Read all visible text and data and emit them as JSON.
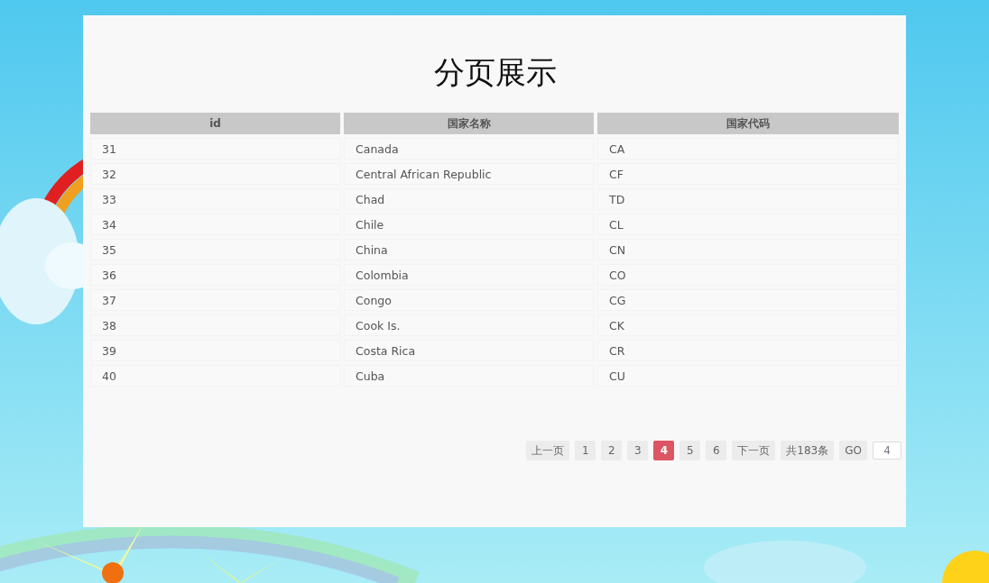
{
  "title": "分页展示",
  "table": {
    "columns": [
      "id",
      "国家名称",
      "国家代码"
    ],
    "rows": [
      [
        "31",
        "Canada",
        "CA"
      ],
      [
        "32",
        "Central African Republic",
        "CF"
      ],
      [
        "33",
        "Chad",
        "TD"
      ],
      [
        "34",
        "Chile",
        "CL"
      ],
      [
        "35",
        "China",
        "CN"
      ],
      [
        "36",
        "Colombia",
        "CO"
      ],
      [
        "37",
        "Congo",
        "CG"
      ],
      [
        "38",
        "Cook Is.",
        "CK"
      ],
      [
        "39",
        "Costa Rica",
        "CR"
      ],
      [
        "40",
        "Cuba",
        "CU"
      ]
    ]
  },
  "pagination": {
    "prev": "上一页",
    "pages": [
      {
        "label": "1",
        "selected": false
      },
      {
        "label": "2",
        "selected": false
      },
      {
        "label": "3",
        "selected": false
      },
      {
        "label": "4",
        "selected": true
      },
      {
        "label": "5",
        "selected": false
      },
      {
        "label": "6",
        "selected": false
      }
    ],
    "next": "下一页",
    "total": "共183条",
    "go": "GO",
    "jump_value": "4"
  }
}
